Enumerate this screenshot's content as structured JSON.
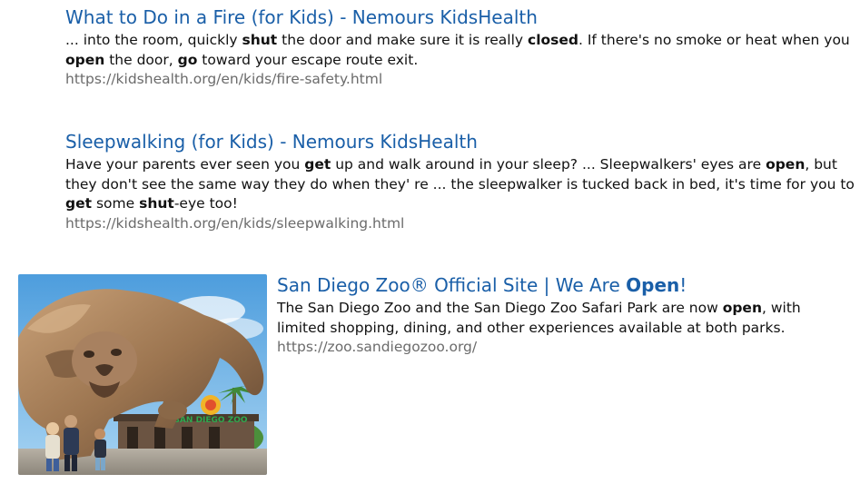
{
  "results": [
    {
      "title": "What to Do in a Fire (for Kids) - Nemours KidsHealth",
      "snippet": [
        {
          "t": "... into the room, quickly "
        },
        {
          "t": "shut",
          "b": true
        },
        {
          "t": " the door and make sure it is really "
        },
        {
          "t": "closed",
          "b": true
        },
        {
          "t": ". If there's no smoke or heat when you "
        },
        {
          "t": "open",
          "b": true
        },
        {
          "t": " the door, "
        },
        {
          "t": "go",
          "b": true
        },
        {
          "t": " toward your escape route exit."
        }
      ],
      "url": "https://kidshealth.org/en/kids/fire-safety.html"
    },
    {
      "title": "Sleepwalking (for Kids) - Nemours KidsHealth",
      "snippet": [
        {
          "t": "Have your parents ever seen you "
        },
        {
          "t": "get",
          "b": true
        },
        {
          "t": " up and walk around in your sleep? ... Sleepwalkers' eyes are "
        },
        {
          "t": "open",
          "b": true
        },
        {
          "t": ", but they don't see the same way they do when they' re ... the sleepwalker is tucked back in bed, it's time for you to "
        },
        {
          "t": "get",
          "b": true
        },
        {
          "t": " some "
        },
        {
          "t": "shut",
          "b": true
        },
        {
          "t": "-eye too!"
        }
      ],
      "url": "https://kidshealth.org/en/kids/sleepwalking.html"
    },
    {
      "title": [
        {
          "t": "San Diego Zoo® Official Site | We Are "
        },
        {
          "t": "Open",
          "b": true
        },
        {
          "t": "!"
        }
      ],
      "snippet": [
        {
          "t": "The San Diego Zoo and the San Diego Zoo Safari Park are now "
        },
        {
          "t": "open",
          "b": true
        },
        {
          "t": ", with limited shopping, dining, and other experiences available at both parks."
        }
      ],
      "url": "https://zoo.sandiegozoo.org/",
      "thumbnail": {
        "icon": "lion-statue-thumbnail",
        "sign_text": "SAN DIEGO ZOO"
      }
    }
  ],
  "colors": {
    "link": "#1a5fa8",
    "url": "#6b6b6b",
    "text": "#111111"
  }
}
